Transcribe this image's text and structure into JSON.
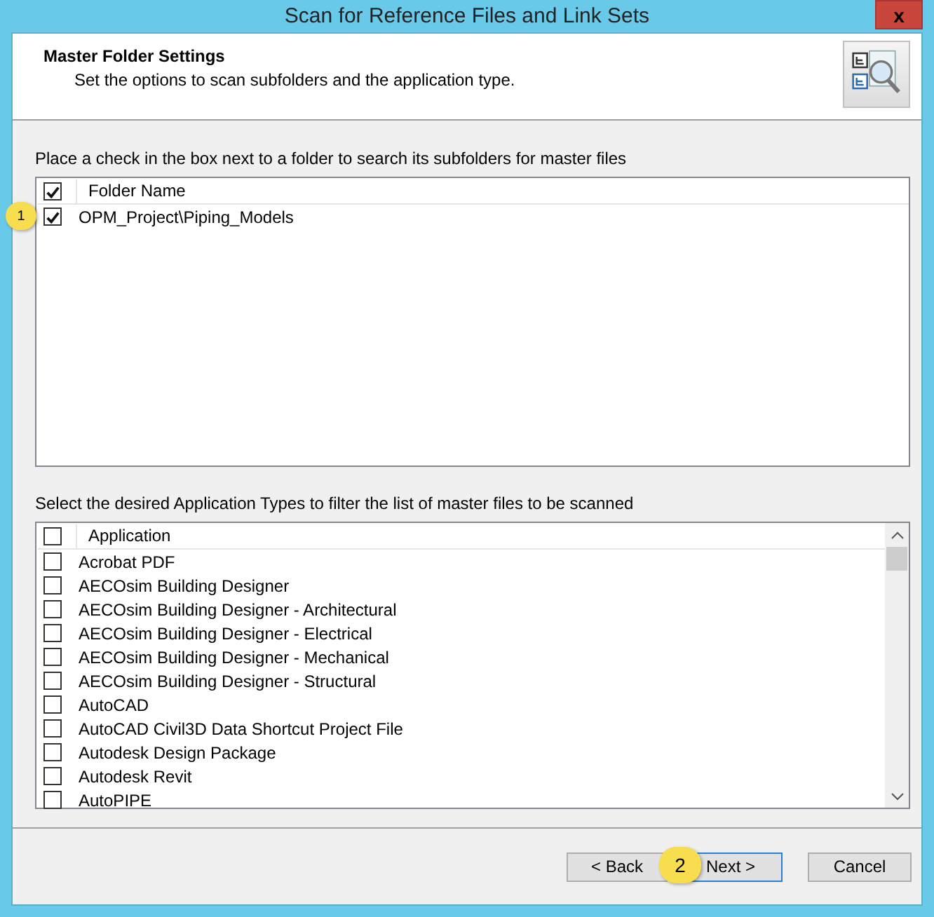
{
  "window": {
    "title": "Scan for Reference Files and Link Sets",
    "close": "x"
  },
  "header": {
    "title": "Master Folder Settings",
    "subtitle": "Set the options to scan subfolders and the application type."
  },
  "folders": {
    "instruction": "Place a check in the box next to a folder to search its subfolders for master files",
    "column": {
      "label": "Folder Name",
      "checked": true
    },
    "rows": [
      {
        "label": "OPM_Project\\Piping_Models",
        "checked": true,
        "callout": "1"
      }
    ]
  },
  "applications": {
    "instruction": "Select the desired Application Types to filter the list of master files to be scanned",
    "column": {
      "label": "Application",
      "checked": false
    },
    "rows": [
      {
        "label": "Acrobat PDF",
        "checked": false
      },
      {
        "label": "AECOsim Building Designer",
        "checked": false
      },
      {
        "label": "AECOsim Building Designer - Architectural",
        "checked": false
      },
      {
        "label": "AECOsim Building Designer - Electrical",
        "checked": false
      },
      {
        "label": "AECOsim Building Designer - Mechanical",
        "checked": false
      },
      {
        "label": "AECOsim Building Designer - Structural",
        "checked": false
      },
      {
        "label": "AutoCAD",
        "checked": false
      },
      {
        "label": "AutoCAD Civil3D Data Shortcut Project File",
        "checked": false
      },
      {
        "label": "Autodesk Design Package",
        "checked": false
      },
      {
        "label": "Autodesk Revit",
        "checked": false
      },
      {
        "label": "AutoPIPE",
        "checked": false
      }
    ]
  },
  "buttons": [
    {
      "label": "< Back",
      "focused": false
    },
    {
      "label": "Next >",
      "focused": true,
      "callout": "2"
    },
    {
      "label": "Cancel",
      "focused": false
    }
  ]
}
